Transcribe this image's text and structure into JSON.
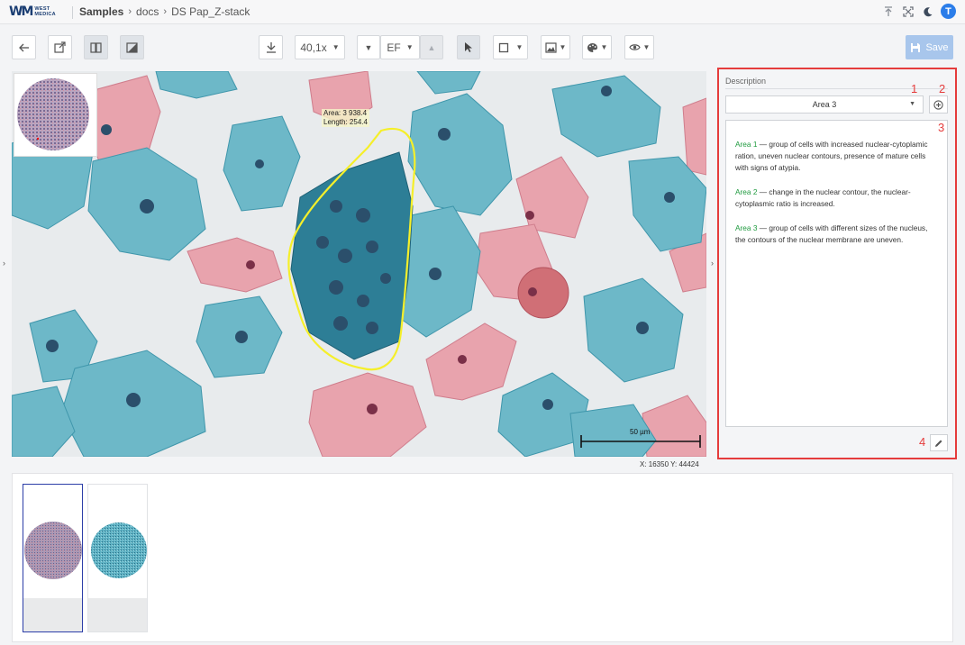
{
  "app": {
    "logo_mark": "WM",
    "logo_text_line1": "WEST",
    "logo_text_line2": "MEDICA"
  },
  "breadcrumb": [
    {
      "label": "Samples",
      "strong": true
    },
    {
      "label": "docs",
      "strong": false
    },
    {
      "label": "DS Pap_Z-stack",
      "strong": false
    }
  ],
  "user": {
    "avatar_letter": "T"
  },
  "toolbar": {
    "zoom": "40,1x",
    "focus_mode": "EF",
    "save_label": "Save"
  },
  "viewer": {
    "measurement_area": "Area: 3 938.4",
    "measurement_length": "Length: 254.4",
    "scalebar": "50 µm",
    "coords": "X: 16350  Y: 44424"
  },
  "description": {
    "title": "Description",
    "selected_area": "Area 3",
    "entries": [
      {
        "name": "Area 1",
        "text": " — group of cells with increased nuclear-cytoplamic ration, uneven nuclear contours, presence of mature cells with signs of atypia."
      },
      {
        "name": "Area 2",
        "text": " — change in the nuclear contour, the nuclear-cytoplasmic ratio is increased."
      },
      {
        "name": "Area 3",
        "text": " — group of cells with different sizes of the nucleus, the contours of the nuclear membrane are uneven."
      }
    ],
    "markers": [
      "1",
      "2",
      "3",
      "4"
    ]
  },
  "colors": {
    "accent": "#2b7de9",
    "highlight_border": "#e53c3c",
    "area_name": "#1e9a3e",
    "annotation": "#f5ef2a"
  }
}
